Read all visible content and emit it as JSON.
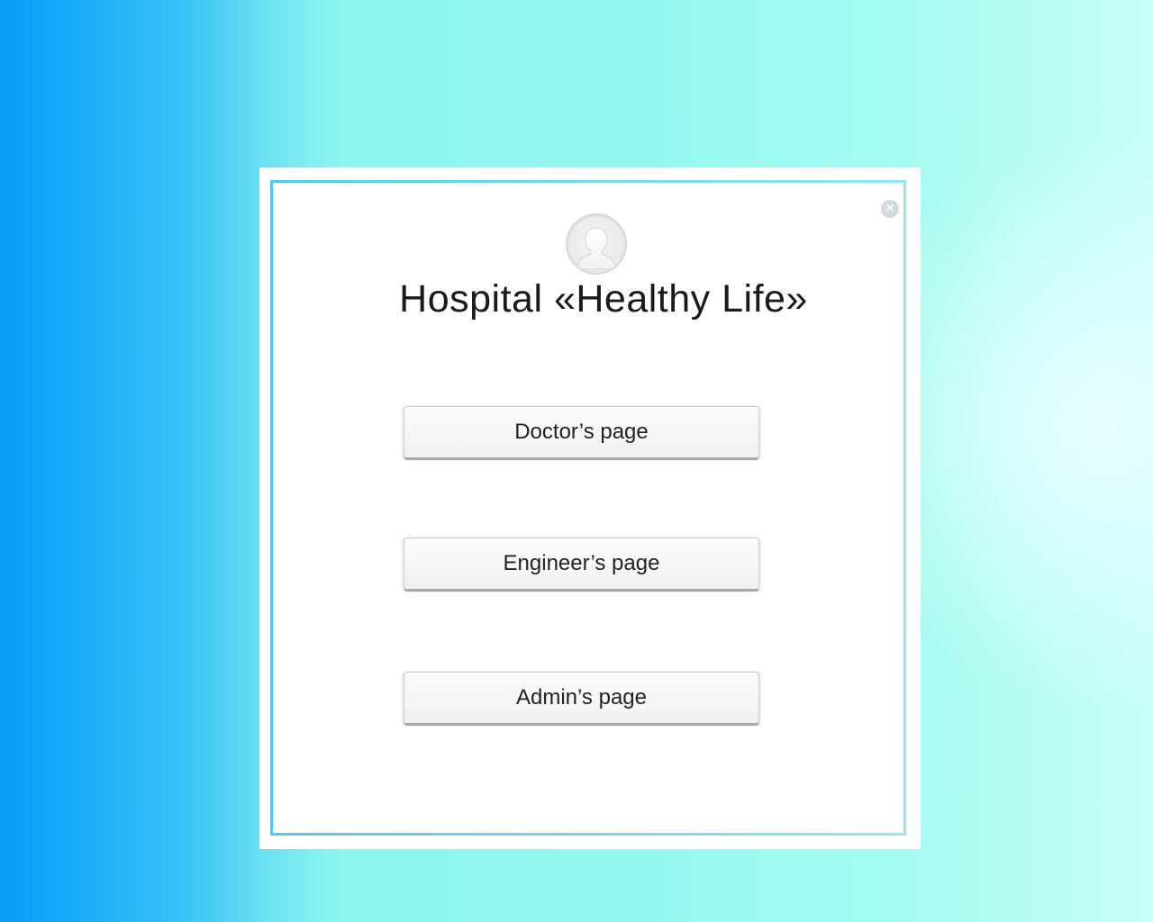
{
  "dialog": {
    "title": "Hospital «Healthy Life»",
    "avatar_icon": "user-silhouette-icon",
    "close_icon": "close-icon",
    "close_glyph": "×"
  },
  "buttons": {
    "doctor_label": "Doctor’s page",
    "engineer_label": "Engineer’s page",
    "admin_label": "Admin’s page"
  },
  "colors": {
    "background_left": "#0a9cf7",
    "background_right": "#93f8f0",
    "frame_border": "#55c7ee",
    "button_face": "#f6f6f6"
  }
}
